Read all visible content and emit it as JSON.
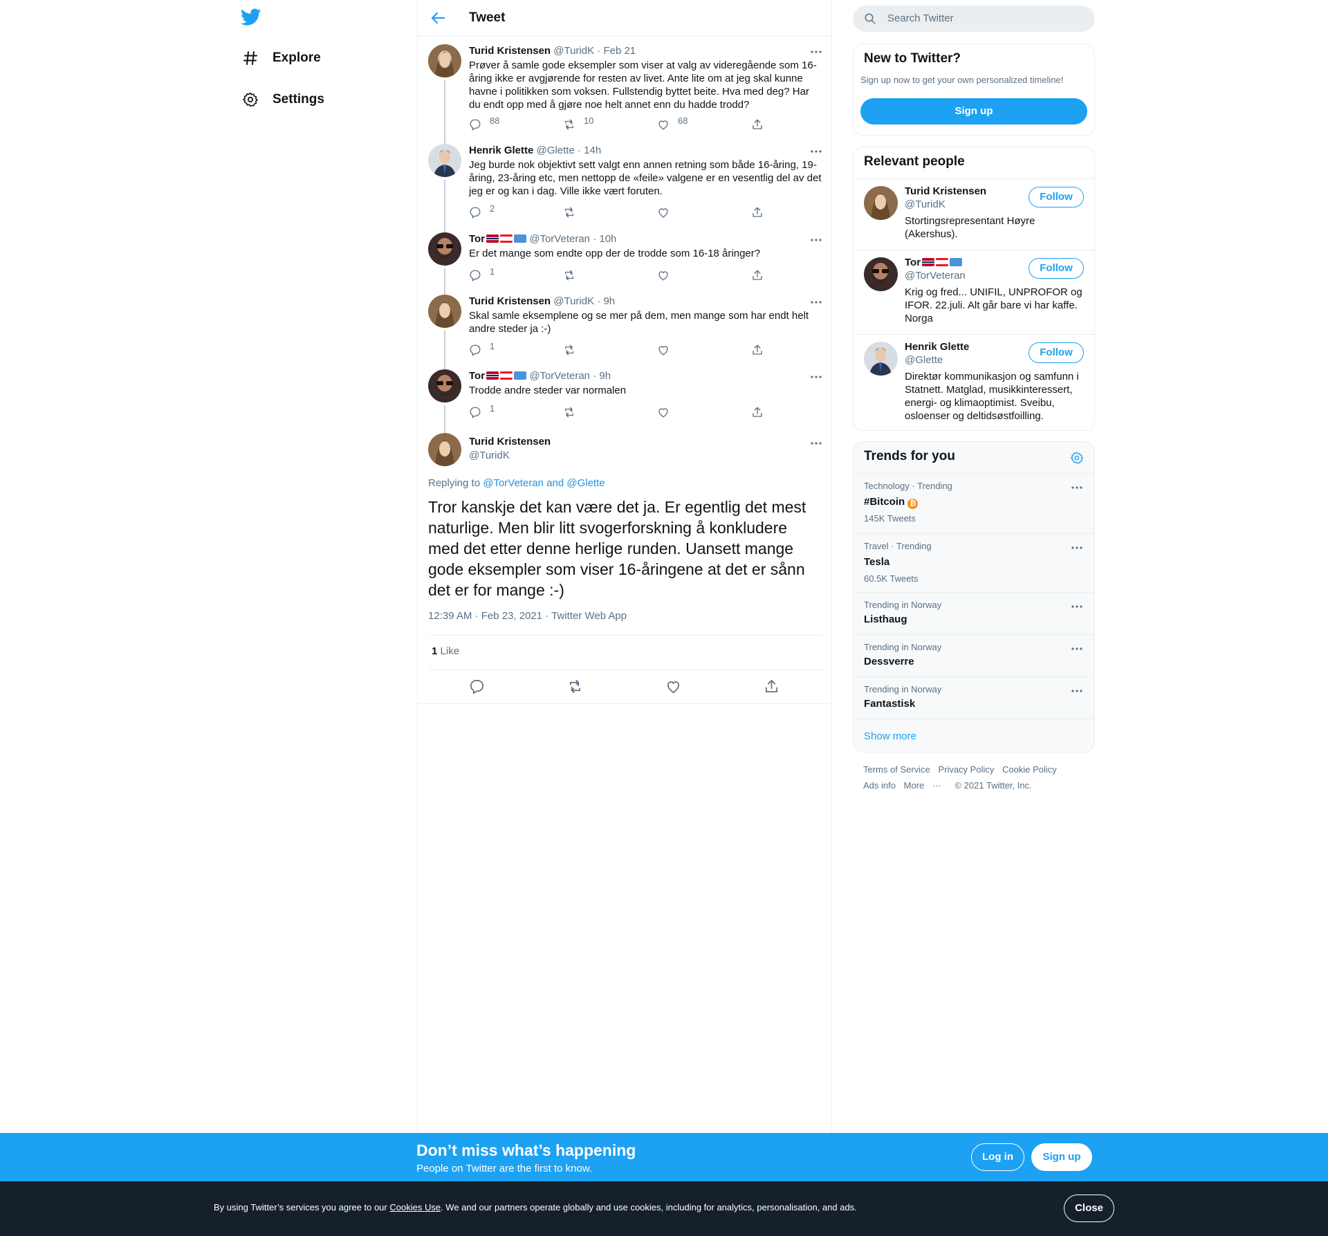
{
  "nav": {
    "items": [
      {
        "label": "Explore",
        "icon": "hashtag-icon"
      },
      {
        "label": "Settings",
        "icon": "gear-icon"
      }
    ]
  },
  "header": {
    "title": "Tweet"
  },
  "thread": [
    {
      "name": "Turid Kristensen",
      "handle": "@TuridK",
      "sep": "·",
      "time": "Feb 21",
      "text": "Prøver å samle gode eksempler som viser at valg av videregående som 16-åring ikke er avgjørende for resten av livet. Ante lite om at jeg skal kunne havne i politikken som voksen. Fullstendig byttet beite. Hva med deg? Har du endt opp med å gjøre noe helt annet enn du hadde trodd?",
      "replies": "88",
      "retweets": "10",
      "likes": "68"
    },
    {
      "name": "Henrik Glette",
      "handle": "@Glette",
      "sep": "·",
      "time": "14h",
      "text": "Jeg burde nok objektivt sett valgt enn annen retning som både 16-åring, 19-åring, 23-åring etc, men nettopp de «feile» valgene er en vesentlig del av det jeg er og kan i dag. Ville ikke vært foruten.",
      "replies": "2",
      "retweets": "",
      "likes": ""
    },
    {
      "name": "Tor",
      "handle": "@TorVeteran",
      "sep": "·",
      "time": "10h",
      "text": "Er det mange som endte opp der de trodde som 16-18 åringer?",
      "replies": "1",
      "retweets": "",
      "likes": ""
    },
    {
      "name": "Turid Kristensen",
      "handle": "@TuridK",
      "sep": "·",
      "time": "9h",
      "text": "Skal samle eksemplene og se mer på dem, men mange som har endt helt andre steder ja :-)",
      "replies": "1",
      "retweets": "",
      "likes": ""
    },
    {
      "name": "Tor",
      "handle": "@TorVeteran",
      "sep": "·",
      "time": "9h",
      "text": "Trodde andre steder var normalen",
      "replies": "1",
      "retweets": "",
      "likes": ""
    }
  ],
  "main_tweet": {
    "name": "Turid Kristensen",
    "handle": "@TuridK",
    "replying_prefix": "Replying to",
    "replying_to": "@TorVeteran and @Glette",
    "text": "Tror kanskje det kan være det ja. Er egentlig det mest naturlige. Men blir litt svogerforskning å konkludere med det etter denne herlige runden. Uansett mange gode eksempler som viser 16-åringene at det er sånn det er for mange :-)",
    "timestamp": "12:39 AM · Feb 23, 2021 · Twitter Web App",
    "like_count": "1",
    "like_label": "Like"
  },
  "search": {
    "placeholder": "Search Twitter"
  },
  "new_to_twitter": {
    "title": "New to Twitter?",
    "subtitle": "Sign up now to get your own personalized timeline!",
    "button": "Sign up"
  },
  "relevant_people": {
    "title": "Relevant people",
    "follow_label": "Follow",
    "people": [
      {
        "name": "Turid Kristensen",
        "handle": "@TuridK",
        "bio": "Stortingsrepresentant Høyre (Akershus)."
      },
      {
        "name": "Tor",
        "handle": "@TorVeteran",
        "bio": "Krig og fred... UNIFIL, UNPROFOR og IFOR. 22.juli. Alt går bare vi har kaffe. Norga"
      },
      {
        "name": "Henrik Glette",
        "handle": "@Glette",
        "bio": "Direktør kommunikasjon og samfunn i Statnett. Matglad, musikkinteressert, energi- og klimaoptimist. Sveibu, osloenser og deltidsøstfoilling."
      }
    ]
  },
  "trends": {
    "title": "Trends for you",
    "items": [
      {
        "category": "Technology · Trending",
        "name": "#Bitcoin",
        "count": "145K Tweets"
      },
      {
        "category": "Travel · Trending",
        "name": "Tesla",
        "count": "60.5K Tweets"
      },
      {
        "category": "Trending in Norway",
        "name": "Listhaug",
        "count": ""
      },
      {
        "category": "Trending in Norway",
        "name": "Dessverre",
        "count": ""
      },
      {
        "category": "Trending in Norway",
        "name": "Fantastisk",
        "count": ""
      }
    ],
    "show_more": "Show more"
  },
  "footer": {
    "terms": "Terms of Service",
    "privacy": "Privacy Policy",
    "cookie": "Cookie Policy",
    "ads": "Ads info",
    "more": "More",
    "copyright": "© 2021 Twitter, Inc."
  },
  "signup_bar": {
    "title": "Don’t miss what’s happening",
    "subtitle": "People on Twitter are the first to know.",
    "login": "Log in",
    "signup": "Sign up"
  },
  "cookie_bar": {
    "prefix": "By using Twitter’s services you agree to our ",
    "link": "Cookies Use",
    "suffix": ". We and our partners operate globally and use cookies, including for analytics, personalisation, and ads.",
    "close": "Close"
  },
  "colors": {
    "accent": "#1da1f2",
    "muted": "#5b7083",
    "cookie_bg": "#15202b"
  }
}
